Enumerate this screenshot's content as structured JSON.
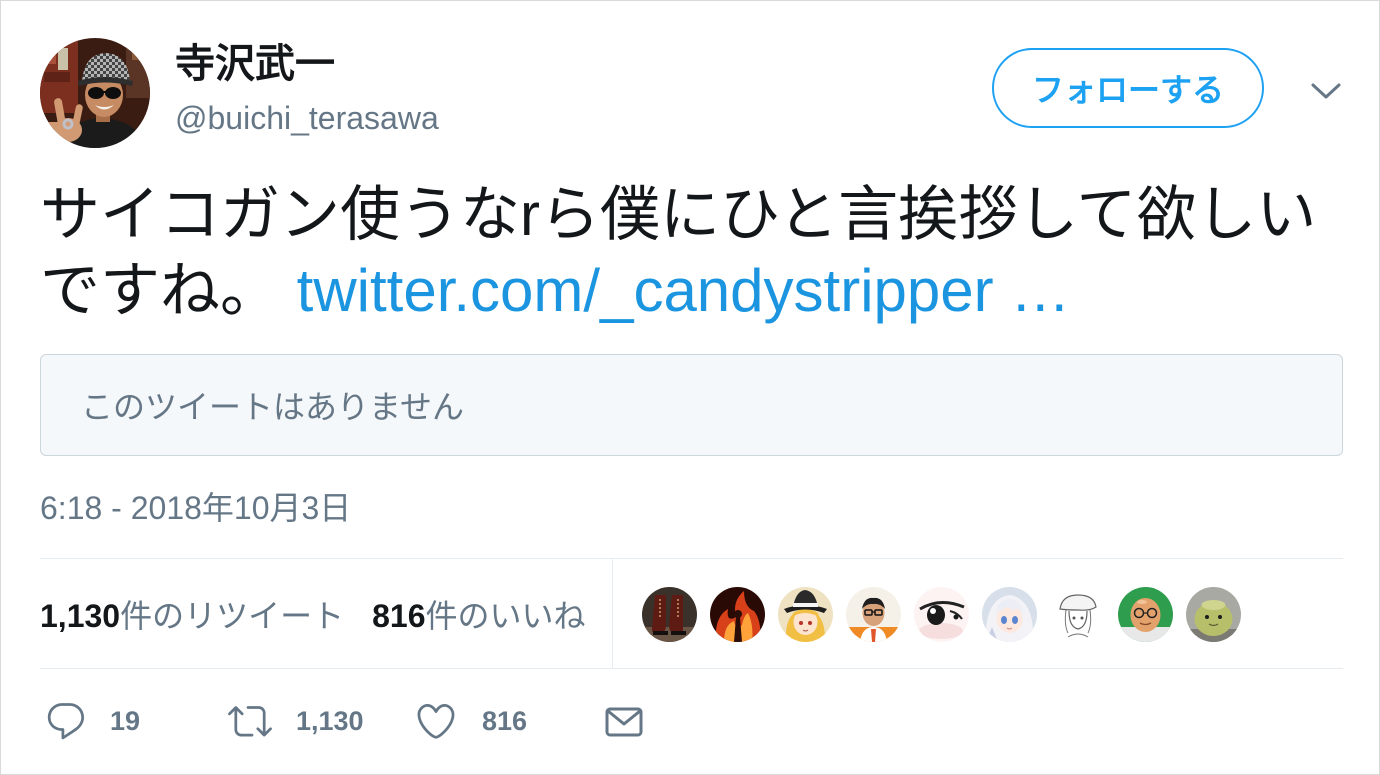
{
  "tweet": {
    "author": {
      "display_name": "寺沢武一",
      "handle": "@buichi_terasawa"
    },
    "follow_label": "フォローする",
    "menu_icon": "chevron-down-icon",
    "text": "サイコガン使うなrら僕にひと言挨拶して欲しいですね。",
    "link_text": "twitter.com/_candystripper …",
    "quote_unavailable": "このツイートはありません",
    "timestamp": "6:18 - 2018年10月3日",
    "stats": {
      "retweets_count": "1,130",
      "retweets_label": "件のリツイート",
      "likes_count": "816",
      "likes_label": "件のいいね"
    },
    "actions": [
      {
        "icon": "reply-icon",
        "count": "19"
      },
      {
        "icon": "retweet-icon",
        "count": "1,130"
      },
      {
        "icon": "heart-icon",
        "count": "816"
      },
      {
        "icon": "envelope-icon"
      }
    ]
  },
  "colors": {
    "accent": "#1da1f2",
    "link": "#1b95e0",
    "text": "#14171a",
    "secondary": "#657786",
    "divider": "#e6ecf0",
    "quote_bg": "#f5f8fa",
    "quote_border": "#ccd6dd"
  }
}
